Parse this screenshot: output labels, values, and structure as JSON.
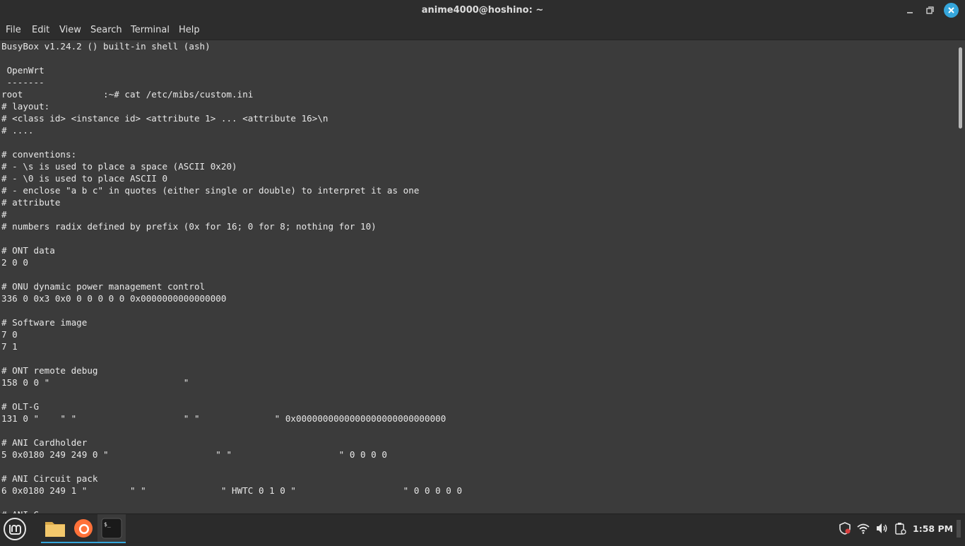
{
  "window": {
    "title": "anime4000@hoshino: ~"
  },
  "menubar": {
    "items": [
      "File",
      "Edit",
      "View",
      "Search",
      "Terminal",
      "Help"
    ]
  },
  "terminal": {
    "lines": [
      "BusyBox v1.24.2 () built-in shell (ash)",
      "",
      " OpenWrt",
      " -------",
      "root               :~# cat /etc/mibs/custom.ini",
      "# layout:",
      "# <class id> <instance id> <attribute 1> ... <attribute 16>\\n",
      "# ....",
      "",
      "# conventions:",
      "# - \\s is used to place a space (ASCII 0x20)",
      "# - \\0 is used to place ASCII 0",
      "# - enclose \"a b c\" in quotes (either single or double) to interpret it as one",
      "# attribute",
      "#",
      "# numbers radix defined by prefix (0x for 16; 0 for 8; nothing for 10)",
      "",
      "# ONT data",
      "2 0 0",
      "",
      "# ONU dynamic power management control",
      "336 0 0x3 0x0 0 0 0 0 0 0x0000000000000000",
      "",
      "# Software image",
      "7 0",
      "7 1",
      "",
      "# ONT remote debug",
      "158 0 0 \"                         \"",
      "",
      "# OLT-G",
      "131 0 \"    \" \"                    \" \"              \" 0x0000000000000000000000000000",
      "",
      "# ANI Cardholder",
      "5 0x0180 249 249 0 \"                    \" \"                    \" 0 0 0 0",
      "",
      "# ANI Circuit pack",
      "6 0x0180 249 1 \"        \" \"              \" HWTC 0 1 0 \"                    \" 0 0 0 0 0",
      "",
      "# ANI-G"
    ]
  },
  "taskbar": {
    "clock": "1:58 PM",
    "apps": [
      {
        "name": "Files"
      },
      {
        "name": "Firefox"
      },
      {
        "name": "Terminal"
      }
    ],
    "terminal_glyph": "$_"
  },
  "colors": {
    "accent": "#35a6dc",
    "terminal_bg": "#3b3b3b",
    "titlebar_bg": "#2d2d2d",
    "taskbar_bg": "#2b2b2b"
  }
}
